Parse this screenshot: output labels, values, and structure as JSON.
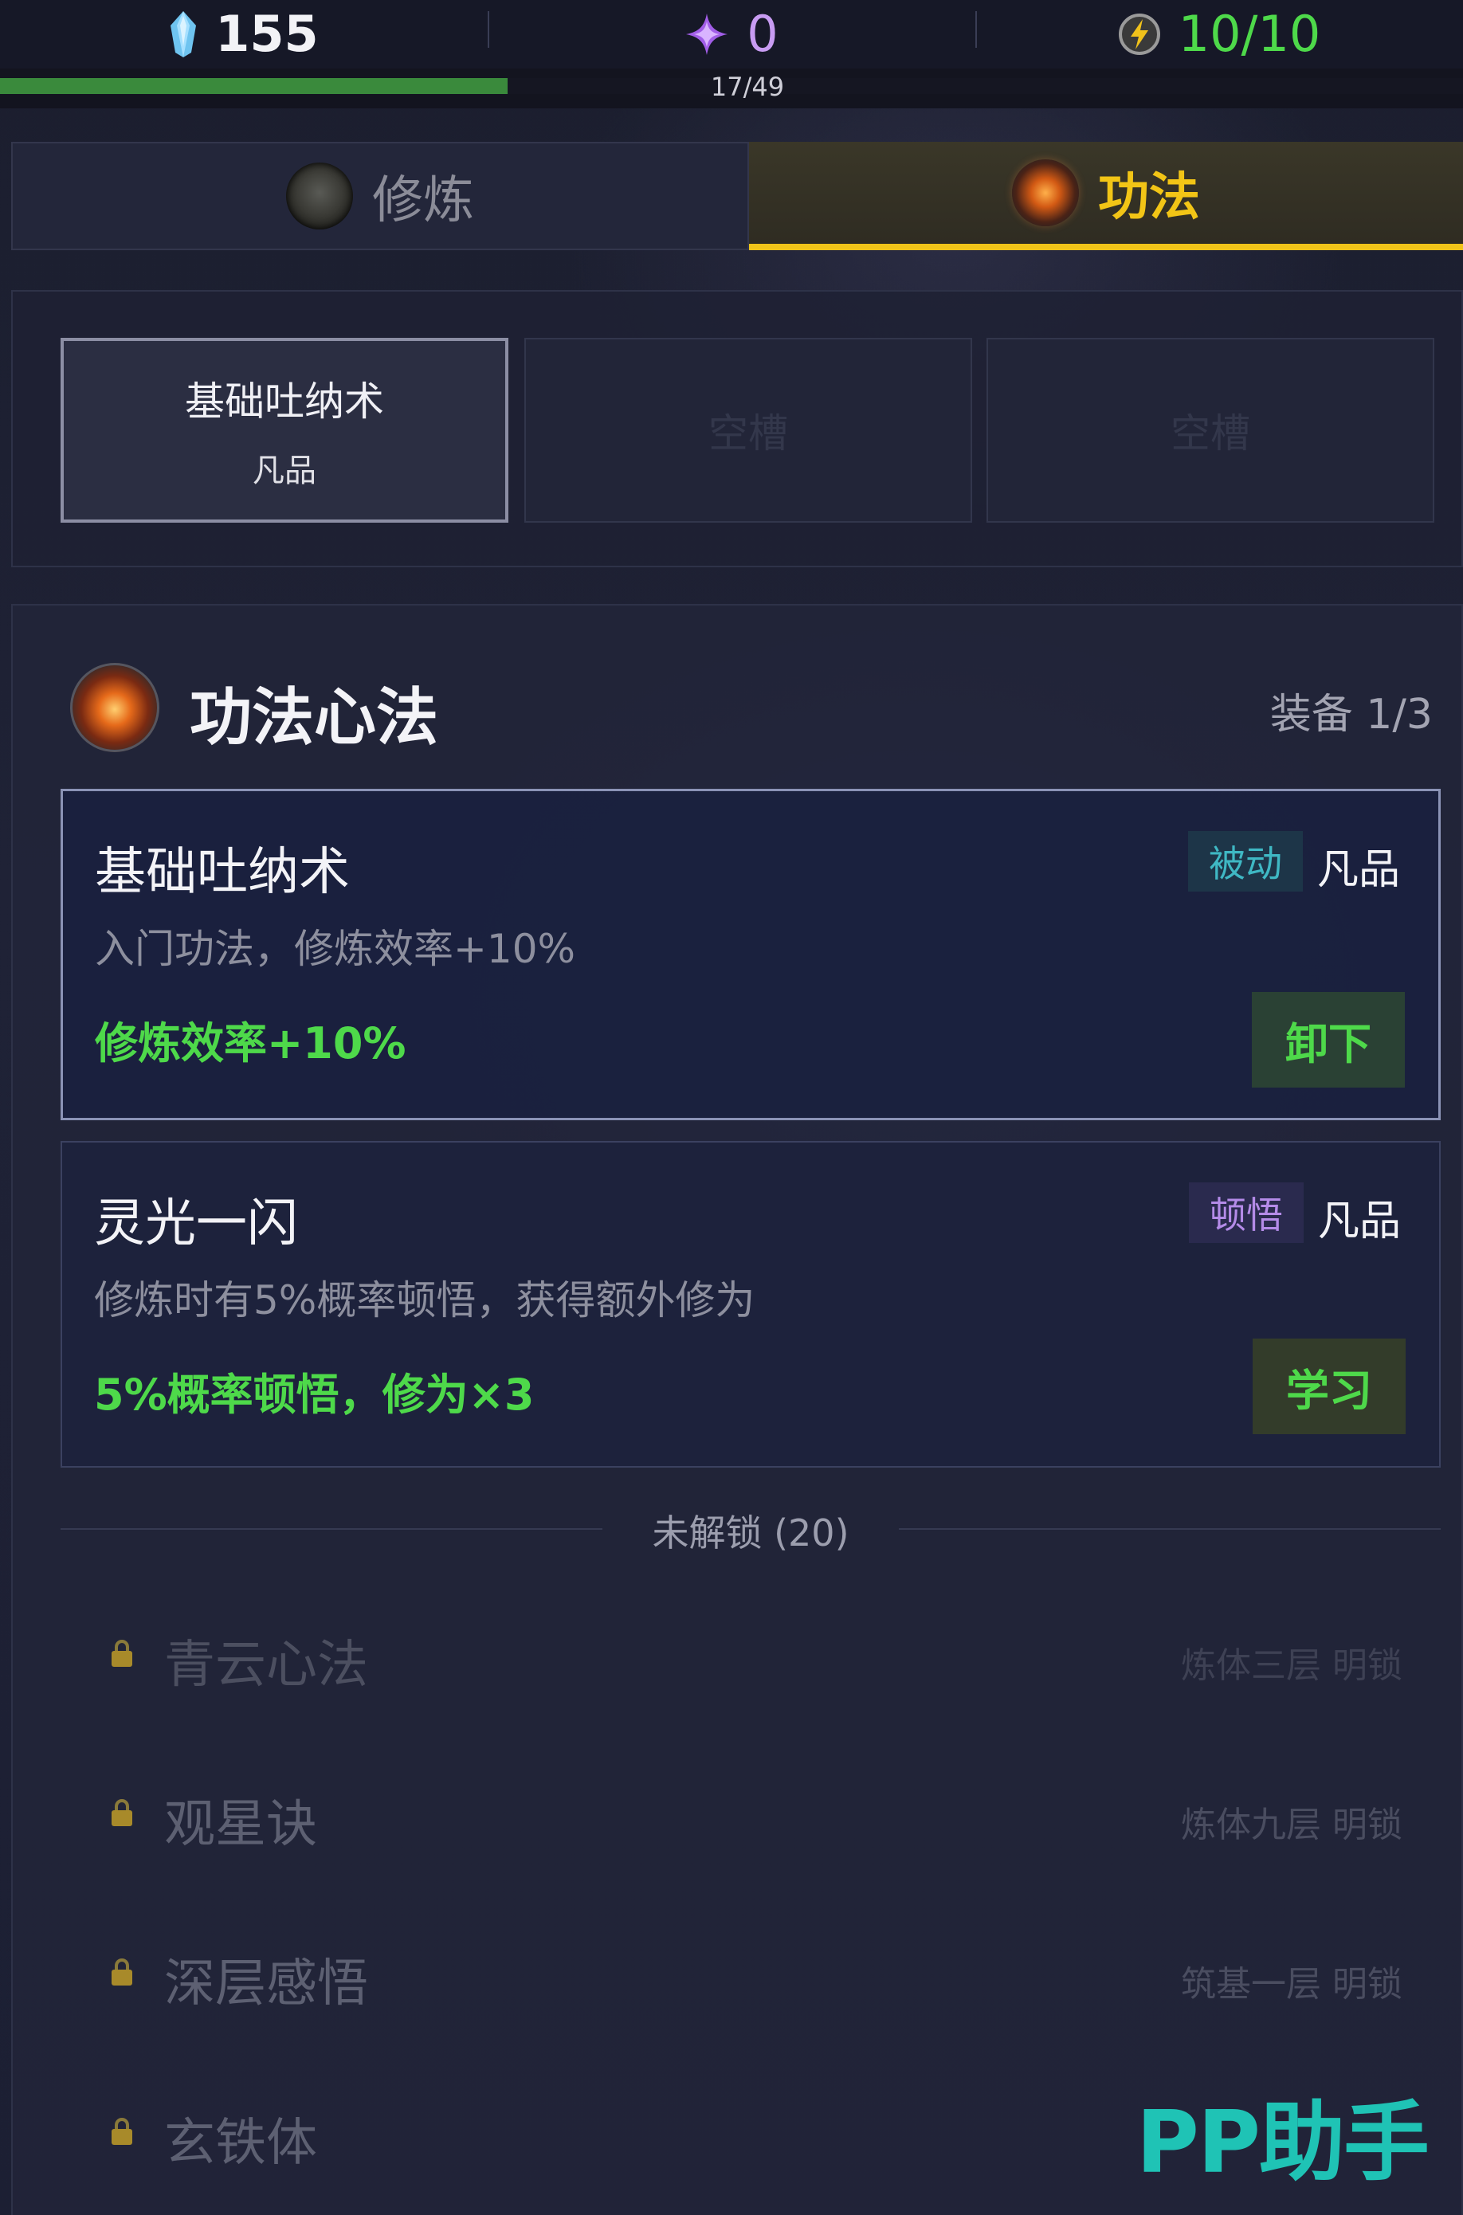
{
  "currencies": {
    "gems": "155",
    "spirit": "0",
    "energy": "10/10"
  },
  "progress": {
    "text": "17/49",
    "fraction": 0.347
  },
  "tabs": [
    {
      "label": "修炼",
      "icon": "cultivation-orb-icon",
      "active": false
    },
    {
      "label": "功法",
      "icon": "technique-orb-icon",
      "active": true
    }
  ],
  "slots": [
    {
      "name": "基础吐纳术",
      "grade": "凡品",
      "state": "equipped"
    },
    {
      "label": "空槽",
      "state": "empty"
    },
    {
      "label": "空槽",
      "state": "empty"
    }
  ],
  "panel": {
    "title": "功法心法",
    "equipped_count": "装备 1/3"
  },
  "techniques": [
    {
      "name": "基础吐纳术",
      "tag": "被动",
      "grade": "凡品",
      "description": "入门功法，修炼效率+10%",
      "effect": "修炼效率+10%",
      "button": "卸下",
      "equipped": true
    },
    {
      "name": "灵光一闪",
      "tag": "顿悟",
      "grade": "凡品",
      "description": "修炼时有5%概率顿悟，获得额外修为",
      "effect": "5%概率顿悟，修为×3",
      "button": "学习",
      "equipped": false
    }
  ],
  "locked": {
    "label": "未解锁 (20)",
    "items": [
      {
        "name": "青云心法",
        "requirement": "炼体三层 明锁"
      },
      {
        "name": "观星诀",
        "requirement": "炼体九层 明锁"
      },
      {
        "name": "深层感悟",
        "requirement": "筑基一层 明锁"
      },
      {
        "name": "玄铁体",
        "requirement": ""
      }
    ]
  },
  "watermark": "PP助手",
  "colors": {
    "accent_gold": "#f0c419",
    "effect_green": "#4ed94a",
    "progress_green": "#3a8a3c",
    "passive_tag": "#3fb8c4",
    "insight_tag": "#b48be8",
    "watermark": "#1fc3b5"
  }
}
